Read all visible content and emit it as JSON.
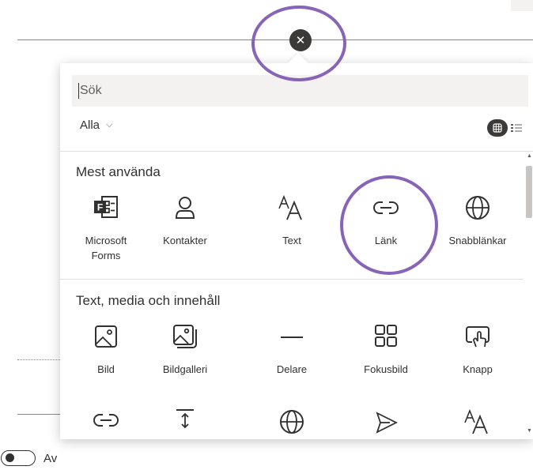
{
  "close_button": {
    "icon": "close-icon",
    "glyph": "✕"
  },
  "search": {
    "placeholder": "Sök"
  },
  "filter": {
    "label": "Alla",
    "chevron": "⌵"
  },
  "view_toggle": {
    "active": "grid"
  },
  "sections": [
    {
      "title": "Mest använda",
      "items": [
        {
          "label": "Microsoft Forms",
          "icon": "microsoft-forms-icon"
        },
        {
          "label": "Kontakter",
          "icon": "person-icon"
        },
        {
          "label": "Text",
          "icon": "text-icon"
        },
        {
          "label": "Länk",
          "icon": "link-icon"
        },
        {
          "label": "Snabblänkar",
          "icon": "globe-icon"
        }
      ]
    },
    {
      "title": "Text, media och innehåll",
      "items": [
        {
          "label": "Bild",
          "icon": "image-icon"
        },
        {
          "label": "Bildgalleri",
          "icon": "image-gallery-icon"
        },
        {
          "label": "Delare",
          "icon": "divider-icon"
        },
        {
          "label": "Fokusbild",
          "icon": "hero-grid-icon"
        },
        {
          "label": "Knapp",
          "icon": "button-touch-icon"
        }
      ]
    }
  ],
  "partial_row": [
    {
      "icon": "link-icon"
    },
    {
      "icon": "spacer-icon"
    },
    {
      "icon": "globe-icon"
    },
    {
      "icon": "send-icon"
    },
    {
      "icon": "text-icon"
    }
  ],
  "toggle": {
    "label": "Av",
    "state": "off"
  },
  "colors": {
    "highlight_ring": "#8764b8",
    "close_bg": "#3b3a39",
    "toggle_active": "#3b3a39"
  }
}
